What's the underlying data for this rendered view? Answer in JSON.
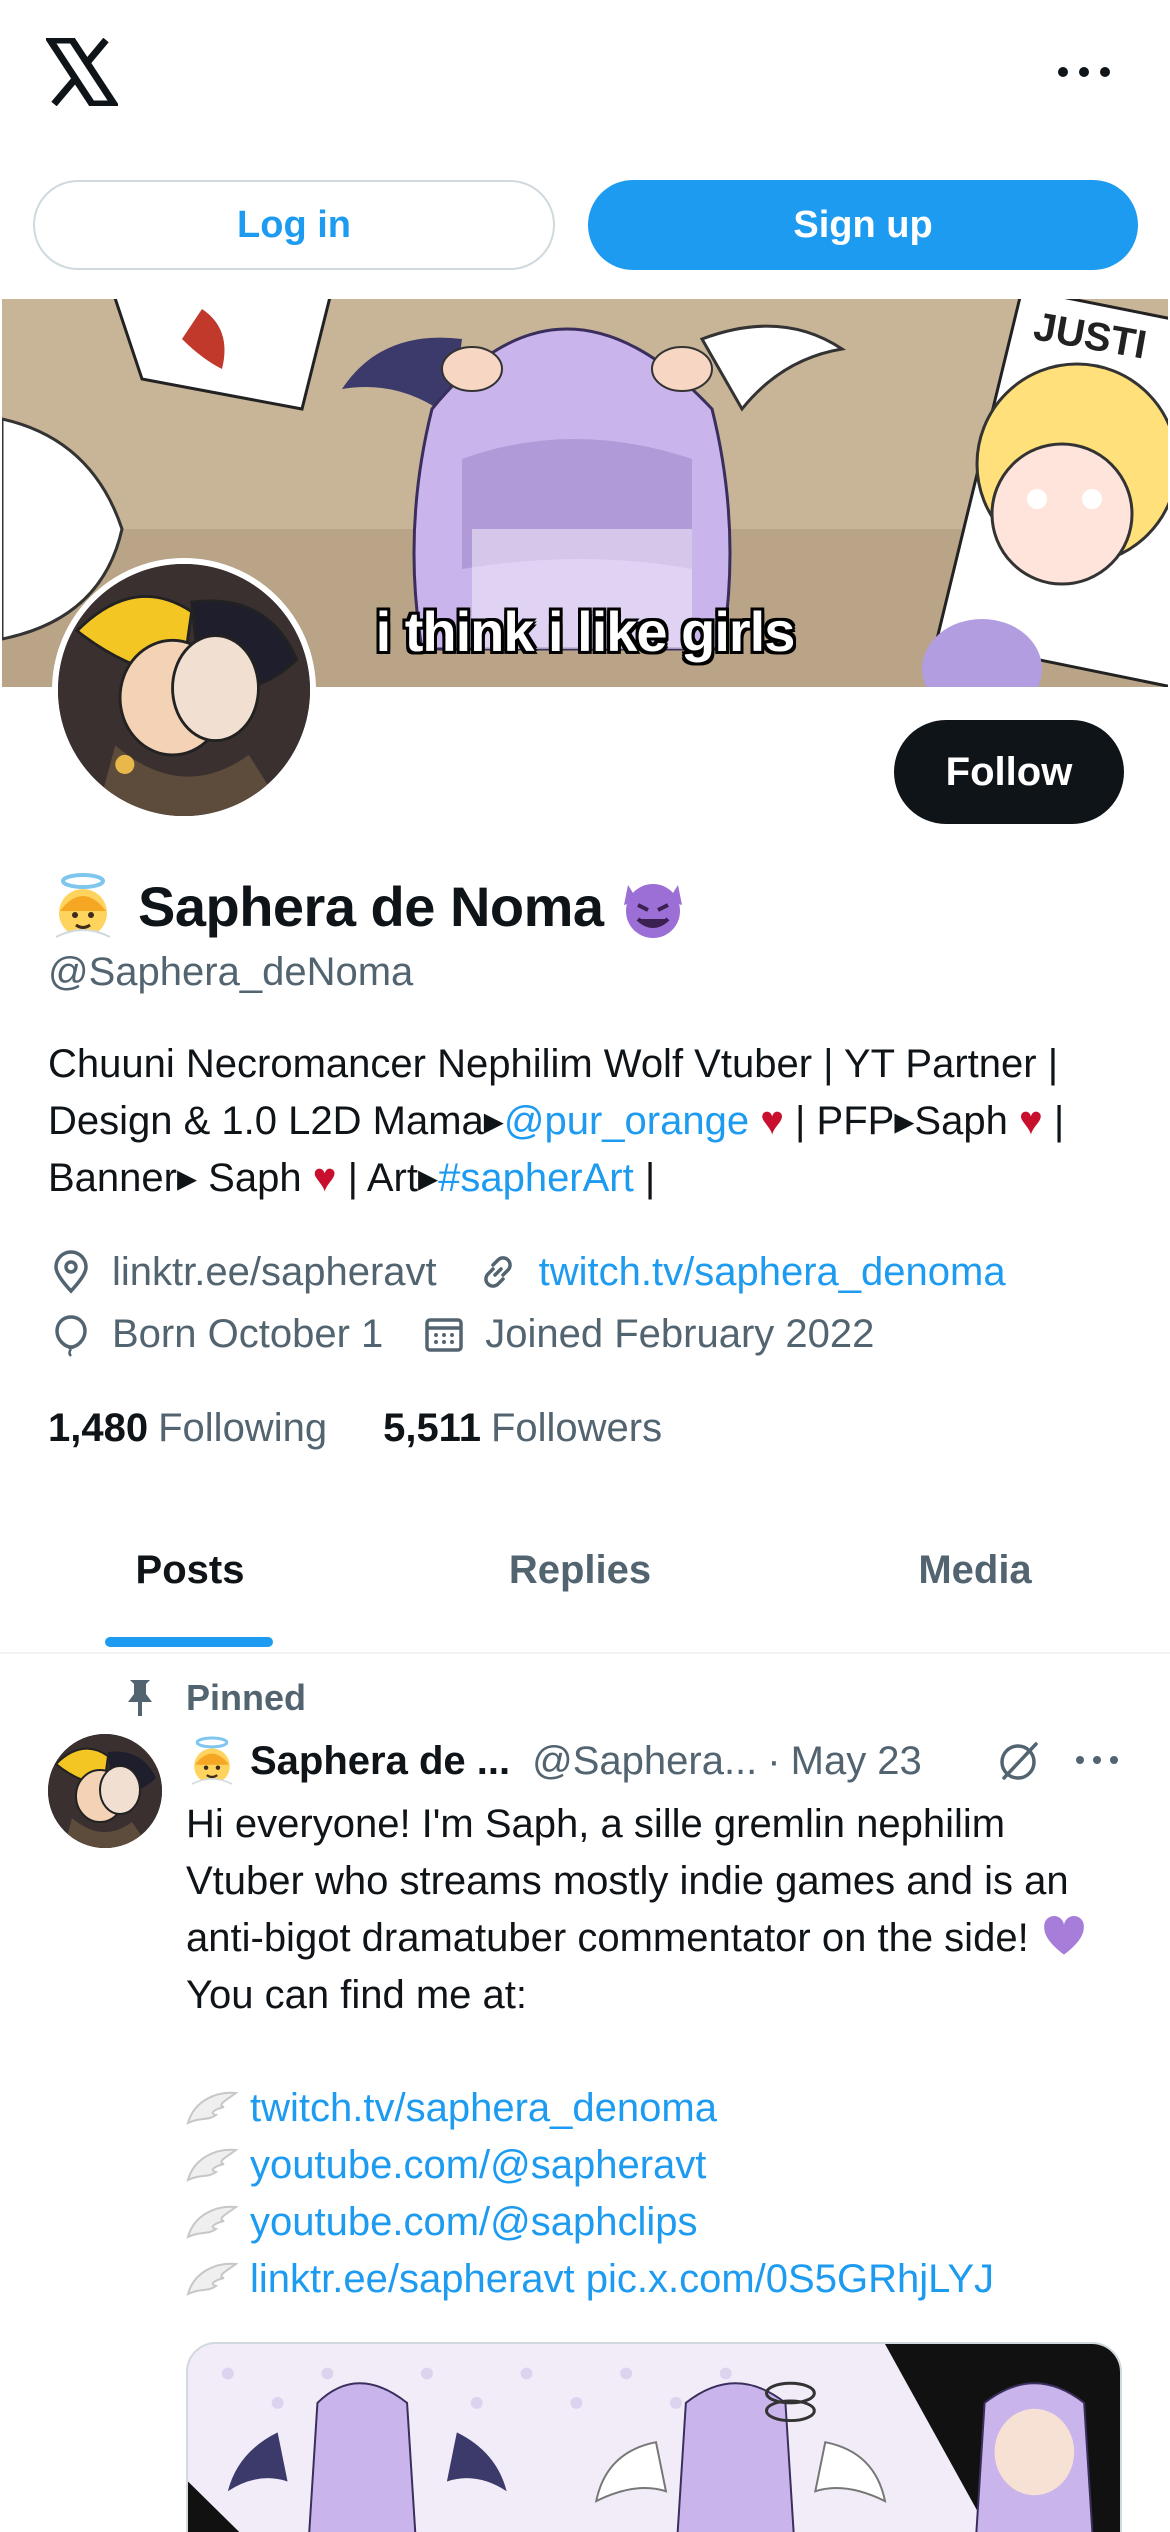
{
  "header": {
    "logo_icon": "x-logo-icon",
    "more_icon": "more-horizontal-icon",
    "login_label": "Log in",
    "signup_label": "Sign up"
  },
  "banner": {
    "caption": "i think i like girls",
    "sign_text": "JUSTI"
  },
  "profile": {
    "name_prefix_emoji": "angel-emoji-icon",
    "display_name": "Saphera de Noma",
    "name_suffix_emoji": "smiling-devil-emoji-icon",
    "handle": "@Saphera_deNoma",
    "follow_label": "Follow",
    "bio": {
      "t1": "Chuuni Necromancer Nephilim Wolf Vtuber | YT Partner | Design & 1.0 L2D Mama▸",
      "mention": "@pur_orange",
      "t2": " | PFP▸Saph ",
      "t3": " | Banner▸ Saph ",
      "t4": " | Art▸",
      "hashtag": "#sapherArt",
      "t5": " |",
      "heart": "♥"
    },
    "location": "linktr.ee/sapheravt",
    "website": "twitch.tv/saphera_denoma",
    "birthday": "Born October 1",
    "joined": "Joined February 2022",
    "following_count": "1,480",
    "following_label": "Following",
    "followers_count": "5,511",
    "followers_label": "Followers"
  },
  "tabs": [
    {
      "label": "Posts",
      "active": true
    },
    {
      "label": "Replies",
      "active": false
    },
    {
      "label": "Media",
      "active": false
    }
  ],
  "pinned_post": {
    "pinned_label": "Pinned",
    "author_name": "Saphera de ...",
    "author_handle": "@Saphera...",
    "date": "May 23",
    "text_before": "Hi everyone! I'm Saph, a sille gremlin nephilim Vtuber who streams mostly indie games and is an anti-bigot dramatuber commentator on the side! ",
    "text_after": " You can find me at:",
    "links": [
      "twitch.tv/saphera_denoma",
      "youtube.com/@sapheravt",
      "youtube.com/@saphclips",
      "linktr.ee/sapheravt pic.x.com/0S5GRhjLYJ"
    ]
  },
  "colors": {
    "accent": "#1d9bf0",
    "text": "#0f1419",
    "muted": "#536471",
    "heart": "#c8102e",
    "purple_heart": "#a67dd9"
  }
}
